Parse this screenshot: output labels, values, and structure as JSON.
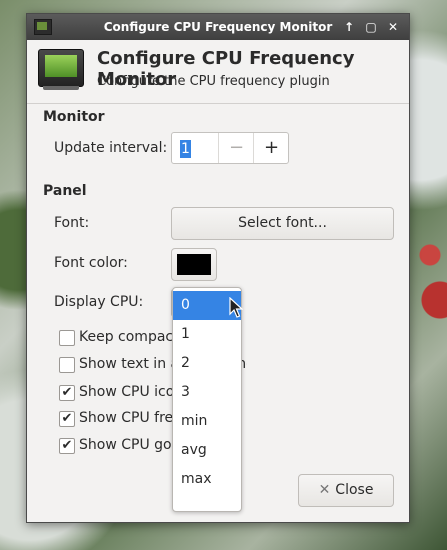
{
  "window": {
    "title": "Configure CPU Frequency Monitor",
    "controls": [
      "↑",
      "▢",
      "✕"
    ]
  },
  "header": {
    "title": "Configure CPU Frequency Monitor",
    "subtitle": "Configure the CPU frequency plugin"
  },
  "monitor": {
    "section": "Monitor",
    "update_interval_label": "Update interval:",
    "update_interval_value": "1",
    "minus": "−",
    "plus": "+"
  },
  "panel": {
    "section": "Panel",
    "font_label": "Font:",
    "font_button": "Select font...",
    "font_color_label": "Font color:",
    "font_color": "#000000",
    "display_cpu_label": "Display CPU:",
    "display_cpu_options": [
      "0",
      "1",
      "2",
      "3",
      "min",
      "avg",
      "max"
    ],
    "display_cpu_selected": "0",
    "checkboxes": [
      {
        "label": "Keep compact",
        "checked": false
      },
      {
        "label": "Show text in a single line",
        "checked": false
      },
      {
        "label": "Show CPU icon",
        "checked": true
      },
      {
        "label": "Show CPU frequency",
        "checked": true
      },
      {
        "label": "Show CPU governor",
        "checked": true
      }
    ]
  },
  "footer": {
    "close_label": "Close"
  }
}
